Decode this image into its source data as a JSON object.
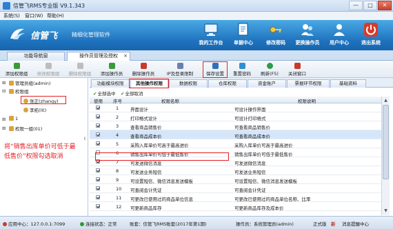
{
  "window": {
    "title": "信管飞RMS专业版 V9.1.343",
    "controls": {
      "minimize": "—",
      "maximize": "□",
      "close": "✕"
    }
  },
  "menu": [
    "系统(S)",
    "窗口(W)",
    "帮助(H)"
  ],
  "banner": {
    "brand": "信管飞",
    "slogan": "精细化管理软件",
    "buttons": [
      {
        "label": "我的工作台",
        "icon": "desktop-icon"
      },
      {
        "label": "单据中心",
        "icon": "document-center-icon"
      },
      {
        "label": "修改密码",
        "icon": "key-icon"
      },
      {
        "label": "更换操作员",
        "icon": "switch-user-icon"
      },
      {
        "label": "用户中心",
        "icon": "user-center-icon"
      },
      {
        "label": "退出系统",
        "icon": "power-icon"
      }
    ]
  },
  "main_tabs": [
    {
      "label": "功能导航窗"
    },
    {
      "label": "操作员管理及授权",
      "active": true,
      "close": "×"
    }
  ],
  "toolbar": [
    {
      "label": "添加权限组",
      "icon": "add-group-icon",
      "color": "#3a9a3a",
      "enabled": true
    },
    {
      "label": "修改权限组",
      "icon": "edit-group-icon",
      "color": "#bdbdbd",
      "enabled": false
    },
    {
      "label": "删除权限组",
      "icon": "delete-group-icon",
      "color": "#bdbdbd",
      "enabled": false
    },
    {
      "label": "添加操作员",
      "icon": "add-operator-icon",
      "color": "#3a9a3a",
      "enabled": true
    },
    {
      "label": "删除操作员",
      "icon": "delete-operator-icon",
      "color": "#c83a2a",
      "enabled": true
    },
    {
      "label": "IP及登录限制",
      "icon": "ip-limit-icon",
      "color": "#6a7fb0",
      "enabled": true
    },
    {
      "label": "保存设置",
      "icon": "save-icon",
      "color": "#2f6fbf",
      "enabled": true
    },
    {
      "label": "重置密码",
      "icon": "reset-password-icon",
      "color": "#2f8fd0",
      "enabled": true
    },
    {
      "label": "刷新(F5)",
      "icon": "refresh-icon",
      "color": "#2f9a4a",
      "enabled": true
    },
    {
      "label": "关闭窗口",
      "icon": "close-window-icon",
      "color": "#c83a2a",
      "enabled": true
    }
  ],
  "tree": {
    "items": [
      {
        "label": "管理员组(admin)",
        "expander": "⊞",
        "icon": "group-icon",
        "color": "#d9a43a"
      },
      {
        "label": "权限组",
        "expander": "⊟",
        "icon": "group-icon",
        "color": "#d9a43a"
      },
      {
        "label": "张正(zhangy)",
        "expander": "",
        "icon": "user-icon",
        "color": "#d9a43a",
        "selected": true
      },
      {
        "label": "李拓(lit)",
        "expander": "",
        "icon": "user-icon",
        "color": "#d9a43a"
      },
      {
        "label": "1",
        "expander": "⊞",
        "icon": "group-icon",
        "color": "#d9a43a"
      },
      {
        "label": "权限一组(01)",
        "expander": "⊞",
        "icon": "group-icon",
        "color": "#d9a43a"
      }
    ]
  },
  "annotation": "将“销售出库单价可低于最低售价”权限勾选取消",
  "perm_tabs": [
    {
      "label": "功能模块权限"
    },
    {
      "label": "其他操作权限",
      "active": true
    },
    {
      "label": "数据权限"
    },
    {
      "label": "仓库权限"
    },
    {
      "label": "资金账户"
    },
    {
      "label": "票据环节权限"
    },
    {
      "label": "基础资料"
    }
  ],
  "select_links": {
    "select_all": "全部选中",
    "cancel_all": "全部取消",
    "check": "✔"
  },
  "grid": {
    "headers": {
      "use": "使用",
      "seq": "序号",
      "name": "权限名称",
      "desc": "权限说明"
    },
    "rows": [
      {
        "use": true,
        "seq": "1",
        "name": "界面设计",
        "desc": "可设计操作界面"
      },
      {
        "use": true,
        "seq": "2",
        "name": "打印格式设计",
        "desc": "可设计打印格式"
      },
      {
        "use": true,
        "seq": "3",
        "name": "查看商品销售价",
        "desc": "可查看商品销售价"
      },
      {
        "use": true,
        "seq": "4",
        "name": "查看商品成本价",
        "desc": "可查看商品成本价",
        "selected": true,
        "marker": "I"
      },
      {
        "use": true,
        "seq": "5",
        "name": "采购入库单价可高于最高进价",
        "desc": "采购入库单价可高于最高进价"
      },
      {
        "use": false,
        "seq": "6",
        "name": "销售出库单价可低于最低售价",
        "desc": "销售出库单价可低于最低售价"
      },
      {
        "use": true,
        "seq": "7",
        "name": "可发送微信消息",
        "desc": "可发送微信消息"
      },
      {
        "use": true,
        "seq": "8",
        "name": "可发送业务短信",
        "desc": "可发送业务短信"
      },
      {
        "use": true,
        "seq": "9",
        "name": "可设置短信、微信消息发送模板",
        "desc": "可设置短信、微信消息发送模板"
      },
      {
        "use": true,
        "seq": "10",
        "name": "可查阅会计凭证",
        "desc": "可查阅会计凭证"
      },
      {
        "use": true,
        "seq": "11",
        "name": "可更改已使用过的商品单位信息",
        "desc": "可更改已使用过的商品单位名称、比率"
      },
      {
        "use": true,
        "seq": "12",
        "name": "可更新商品库存",
        "desc": "可更新商品库存及成本价"
      }
    ]
  },
  "scrollbar": {
    "up": "▲",
    "down": "▼"
  },
  "statusbar": {
    "app_center": "应用中心：127.0.0.1:7099",
    "connection": "连接状态：正常",
    "account": "账套：信管飞RMS账套(2017年第1期)",
    "operator": "操作员：系统管理员(admin)",
    "edition": "正式版",
    "register": "新",
    "messages": "消息提醒中心",
    "connection_color": "#2e9a2e",
    "app_color": "#c83a2a"
  }
}
